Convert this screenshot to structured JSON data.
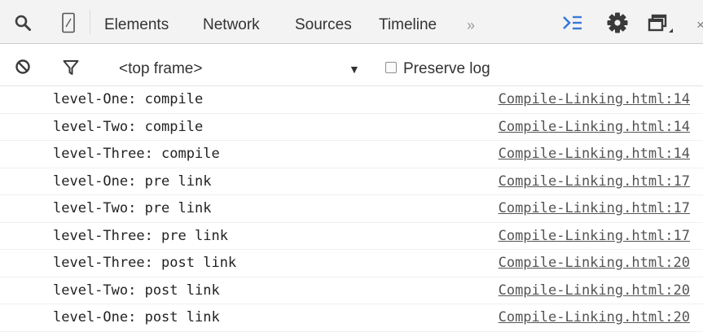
{
  "toolbar": {
    "tabs": [
      {
        "label": "Elements"
      },
      {
        "label": "Network"
      },
      {
        "label": "Sources"
      },
      {
        "label": "Timeline"
      }
    ],
    "overflow": "»",
    "icons": {
      "search": "search-icon",
      "device": "device-mode-icon",
      "drawer": "console-drawer-icon",
      "settings": "gear-icon",
      "dock": "dock-side-icon"
    },
    "accent_color": "#3879d9"
  },
  "filter_bar": {
    "frame_select": "<top frame>",
    "preserve_log_label": "Preserve log",
    "preserve_log_checked": false
  },
  "console": {
    "messages": [
      {
        "text": "level-One: compile",
        "source": "Compile-Linking.html:14"
      },
      {
        "text": "level-Two: compile",
        "source": "Compile-Linking.html:14"
      },
      {
        "text": "level-Three: compile",
        "source": "Compile-Linking.html:14"
      },
      {
        "text": "level-One: pre link",
        "source": "Compile-Linking.html:17"
      },
      {
        "text": "level-Two: pre link",
        "source": "Compile-Linking.html:17"
      },
      {
        "text": "level-Three: pre link",
        "source": "Compile-Linking.html:17"
      },
      {
        "text": "level-Three: post link",
        "source": "Compile-Linking.html:20"
      },
      {
        "text": "level-Two: post link",
        "source": "Compile-Linking.html:20"
      },
      {
        "text": "level-One: post link",
        "source": "Compile-Linking.html:20"
      }
    ]
  }
}
